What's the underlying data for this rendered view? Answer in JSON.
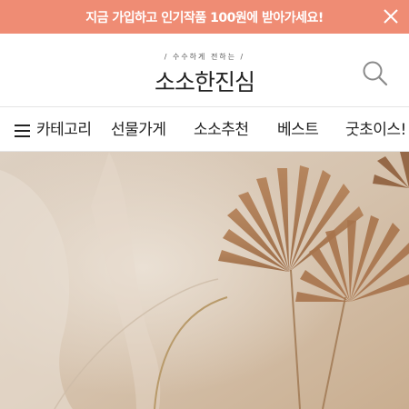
{
  "promo": {
    "text": "지금 가입하고 인기작품 100원에 받아가세요!"
  },
  "header": {
    "tagline": "/ 수수하게 전하는 /",
    "brand": "소소한진심"
  },
  "nav": {
    "category_label": "카테고리",
    "items": [
      "선물가게",
      "소소추천",
      "베스트",
      "굿초이스!"
    ]
  },
  "colors": {
    "promo_bg": "#ef8c74",
    "promo_text": "#ffffff",
    "hero_bg": "#d9c7b0"
  },
  "icons": {
    "close": "close-icon",
    "search": "search-icon",
    "menu": "hamburger-menu-icon"
  }
}
